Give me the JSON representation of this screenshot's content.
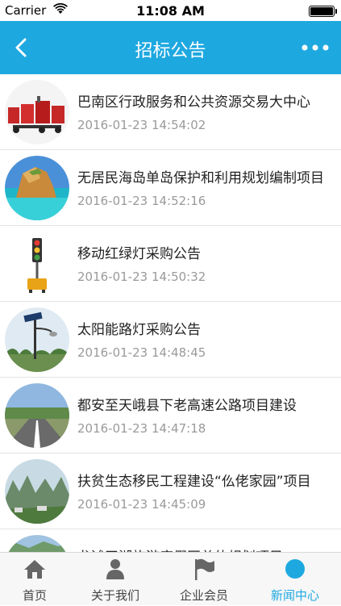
{
  "status_bar": {
    "carrier": "Carrier",
    "time": "11:08 AM"
  },
  "nav": {
    "title": "招标公告"
  },
  "colors": {
    "accent": "#1ea8e0",
    "tab_inactive": "#666666"
  },
  "articles": [
    {
      "title": "巴南区行政服务和公共资源交易大中心",
      "date": "2016-01-23 14:54:02",
      "thumb": "red-equipment"
    },
    {
      "title": "无居民海岛单岛保护和利用规划编制项目",
      "date": "2016-01-23 14:52:16",
      "thumb": "island-rock"
    },
    {
      "title": "移动红绿灯采购公告",
      "date": "2016-01-23 14:50:32",
      "thumb": "traffic-light"
    },
    {
      "title": "太阳能路灯采购公告",
      "date": "2016-01-23 14:48:45",
      "thumb": "solar-streetlight"
    },
    {
      "title": "都安至天峨县下老高速公路项目建设",
      "date": "2016-01-23 14:47:18",
      "thumb": "highway"
    },
    {
      "title": "扶贫生态移民工程建设“仫佬家园”项目",
      "date": "2016-01-23 14:45:09",
      "thumb": "karst-mountains"
    },
    {
      "title": "龙滩天湖旅游度假区总体规划项目",
      "date": "",
      "thumb": "lake"
    }
  ],
  "tabs": [
    {
      "label": "首页",
      "icon": "home-icon",
      "active": false
    },
    {
      "label": "关于我们",
      "icon": "person-icon",
      "active": false
    },
    {
      "label": "企业会员",
      "icon": "flag-icon",
      "active": false
    },
    {
      "label": "新闻中心",
      "icon": "dot-icon",
      "active": true
    }
  ]
}
